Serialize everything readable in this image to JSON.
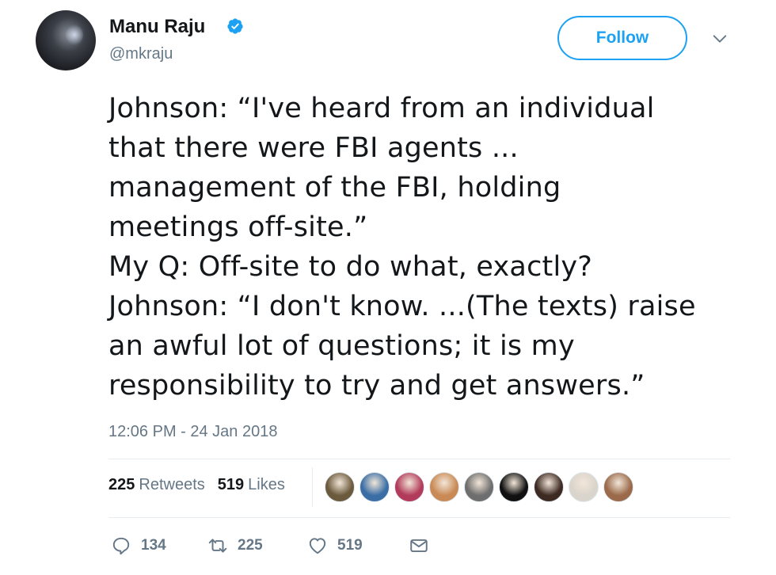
{
  "author": {
    "name": "Manu Raju",
    "handle": "@mkraju",
    "verified_icon": "verified-badge-icon",
    "verified_color": "#1da1f2"
  },
  "follow_label": "Follow",
  "tweet": {
    "text": "Johnson: “I've heard from an individual\nthat there were FBI agents ...\nmanagement of the FBI, holding\nmeetings off-site.”\nMy Q: Off-site to do what, exactly?\nJohnson: “I don't know. ...(The texts) raise\nan awful lot of questions; it is my\nresponsibility to try and get answers.”",
    "timestamp": "12:06 PM - 24 Jan 2018"
  },
  "stats": {
    "retweets_count": "225",
    "retweets_label": "Retweets",
    "likes_count": "519",
    "likes_label": "Likes"
  },
  "liker_avatars": [
    {
      "color": "#6b5a3c"
    },
    {
      "color": "#3a6ea5"
    },
    {
      "color": "#b23a5a"
    },
    {
      "color": "#c98a55"
    },
    {
      "color": "#6e6e6e"
    },
    {
      "color": "#111111"
    },
    {
      "color": "#3d2a22"
    },
    {
      "color": "#d9d4cc"
    },
    {
      "color": "#9a6a4a"
    }
  ],
  "actions": {
    "reply_count": "134",
    "retweet_count": "225",
    "like_count": "519"
  },
  "colors": {
    "accent": "#1da1f2",
    "muted": "#657786",
    "text": "#14171a",
    "divider": "#e6ecf0"
  }
}
